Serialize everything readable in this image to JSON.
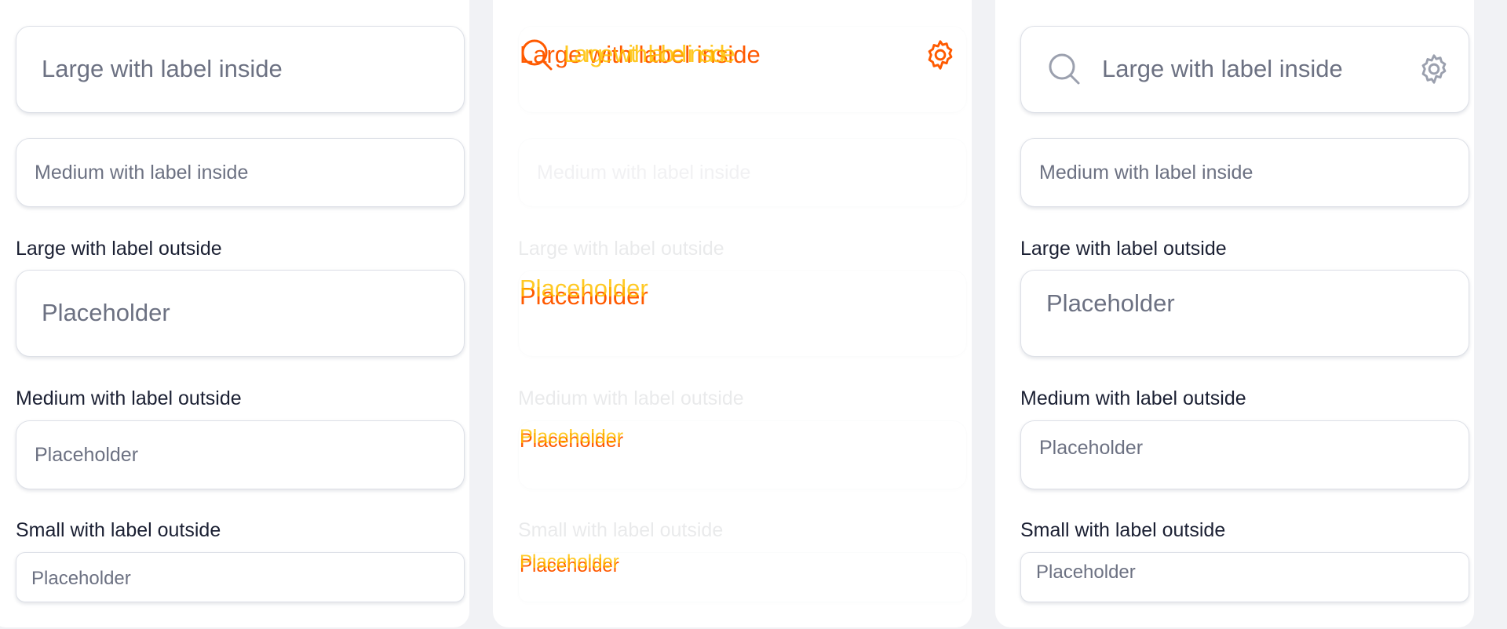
{
  "columns": [
    {
      "id": "default",
      "large_inside": {
        "text": "Large with label inside"
      },
      "medium_inside": {
        "text": "Medium with label inside"
      },
      "large_outside": {
        "label": "Large with label outside",
        "placeholder": "Placeholder"
      },
      "medium_outside": {
        "label": "Medium with label outside",
        "placeholder": "Placeholder"
      },
      "small_outside": {
        "label": "Small with label outside",
        "placeholder": "Placeholder"
      }
    },
    {
      "id": "disabled",
      "large_inside": {
        "text": "Large with label inside",
        "ghost_text": "Large with label inside"
      },
      "medium_inside": {
        "text": "Medium with label inside"
      },
      "large_outside": {
        "label": "Large with label outside",
        "placeholder": "Placeholder"
      },
      "medium_outside": {
        "label": "Medium with label outside",
        "placeholder": "Placeholder"
      },
      "small_outside": {
        "label": "Small with label outside",
        "placeholder": "Placeholder"
      }
    },
    {
      "id": "with-icons",
      "large_inside": {
        "text": "Large with label inside"
      },
      "medium_inside": {
        "text": "Medium with label inside"
      },
      "large_outside": {
        "label": "Large with label outside",
        "placeholder": "Placeholder"
      },
      "medium_outside": {
        "label": "Medium with label outside",
        "placeholder": "Placeholder"
      },
      "small_outside": {
        "label": "Small with label outside",
        "placeholder": "Placeholder"
      }
    }
  ],
  "icons": {
    "left": "search-icon",
    "right": "gear-icon"
  },
  "colors": {
    "background": "#f1f2f5",
    "panel": "#ffffff",
    "field_border": "#dde0e7",
    "label_text": "#1b2033",
    "placeholder_text": "#6c7182",
    "icon": "#9ba0ae",
    "glitch_orange": "#ff5a00",
    "glitch_yellow": "#ffc000"
  }
}
